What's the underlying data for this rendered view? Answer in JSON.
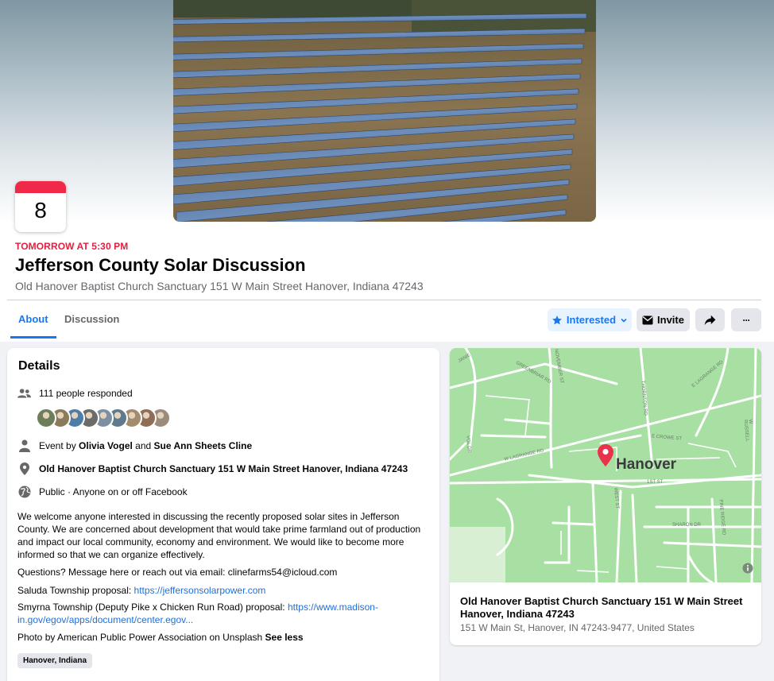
{
  "event": {
    "day": "8",
    "when": "TOMORROW AT 5:30 PM",
    "title": "Jefferson County Solar Discussion",
    "location_line": "Old Hanover Baptist Church Sanctuary 151 W Main Street Hanover, Indiana 47243"
  },
  "tabs": [
    {
      "label": "About"
    },
    {
      "label": "Discussion"
    }
  ],
  "actions": {
    "interested": "Interested",
    "invite": "Invite",
    "more": "···"
  },
  "details": {
    "heading": "Details",
    "responded": "111 people responded",
    "event_by_prefix": "Event by ",
    "host1": "Olivia Vogel",
    "and": " and ",
    "host2": "Sue Ann Sheets Cline",
    "venue": "Old Hanover Baptist Church Sanctuary 151 W Main Street Hanover, Indiana 47243",
    "privacy": "Public · Anyone on or off Facebook",
    "description": "We welcome anyone interested in discussing the recently proposed solar sites in Jefferson County. We are concerned about development that would take prime farmland out of production and impact our local community, economy and environment. We would like to become more informed so that we can organize effectively.",
    "questions": "Questions? Message here or reach out via email: clinefarms54@icloud.com",
    "saluda_prefix": "Saluda Township proposal: ",
    "saluda_link": "https://jeffersonsolarpower.com",
    "smyrna_prefix": "Smyrna Township (Deputy Pike x Chicken Run Road) proposal: ",
    "smyrna_link": "https://www.madison-in.gov/egov/apps/document/center.egov...",
    "photo_credit": "Photo by American Public Power Association on Unsplash ",
    "see_less": "See less",
    "tag": "Hanover, Indiana",
    "avatar_colors": [
      "#6d7f5a",
      "#8b7a5c",
      "#4e7ea8",
      "#6b6b6b",
      "#7d8fa3",
      "#5f7a8f",
      "#a38b6d",
      "#8e6e56",
      "#9b8d7a"
    ]
  },
  "map": {
    "town": "Hanover",
    "streets": [
      "JANIE",
      "GREENBRIAR RD",
      "NOVEMBER ST",
      "THORNTON RD",
      "E LAGRANGE RD",
      "VOL DR",
      "W LAGRANGE RD",
      "E CROWE ST",
      "1ST ST",
      "WEST ST",
      "SHARON DR",
      "PINE RIDGE RD",
      "W RUSSELL"
    ],
    "venue_title": "Old Hanover Baptist Church Sanctuary 151 W Main Street Hanover, Indiana 47243",
    "address": "151 W Main St, Hanover, IN 47243-9477, United States"
  },
  "colors": {
    "accent": "#1877f2",
    "date_red": "#e41e3f",
    "map_green": "#a8e0a4",
    "pin": "#e8334a"
  }
}
